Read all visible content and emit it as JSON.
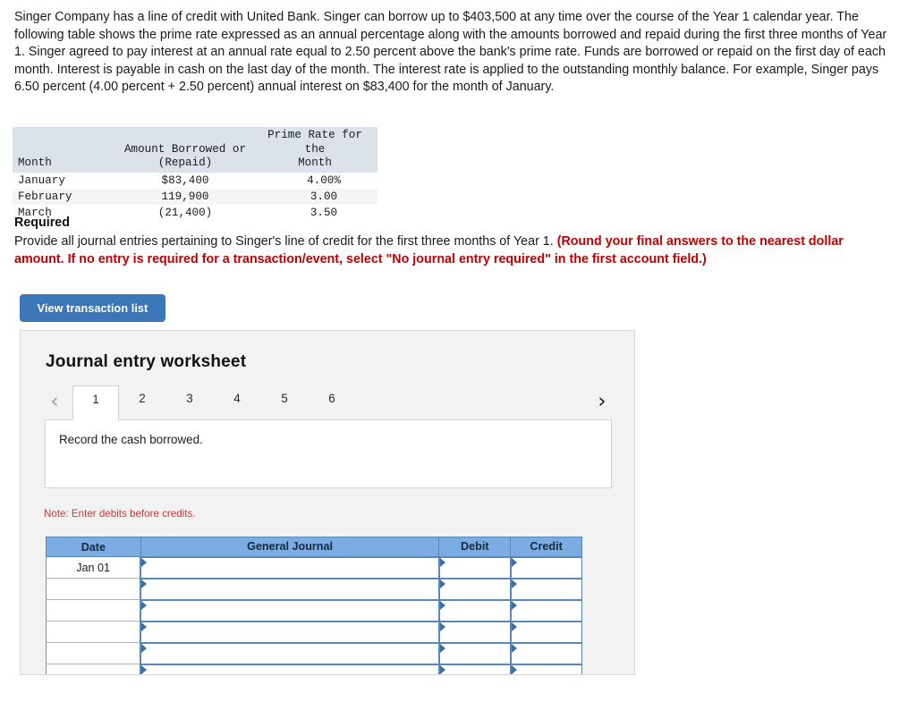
{
  "problem": {
    "text": "Singer Company has a line of credit with United Bank. Singer can borrow up to $403,500 at any time over the course of the Year 1 calendar year. The following table shows the prime rate expressed as an annual percentage along with the amounts borrowed and repaid during the first three months of Year 1. Singer agreed to pay interest at an annual rate equal to 2.50 percent above the bank's prime rate. Funds are borrowed or repaid on the first day of each month. Interest is payable in cash on the last day of the month. The interest rate is applied to the outstanding monthly balance. For example, Singer pays 6.50 percent (4.00 percent + 2.50 percent) annual interest on $83,400 for the month of January."
  },
  "data_table": {
    "headers": {
      "month": "Month",
      "amount_line1": "Amount Borrowed or",
      "amount_line2": "(Repaid)",
      "rate_line1": "Prime Rate for the",
      "rate_line2": "Month"
    },
    "rows": [
      {
        "month": "January",
        "amount": "$83,400",
        "rate": "4.00%"
      },
      {
        "month": "February",
        "amount": "119,900",
        "rate": "3.00"
      },
      {
        "month": "March",
        "amount": "(21,400)",
        "rate": "3.50"
      }
    ]
  },
  "required": {
    "heading": "Required",
    "body": "Provide all journal entries pertaining to Singer's line of credit for the first three months of Year 1. ",
    "hint": "(Round your final answers to the nearest dollar amount. If no entry is required for a transaction/event, select \"No journal entry required\" in the first account field.)"
  },
  "buttons": {
    "view_transaction_list": "View transaction list"
  },
  "worksheet": {
    "title": "Journal entry worksheet",
    "prev_icon": "chevron-left-icon",
    "next_icon": "chevron-right-icon",
    "tabs": [
      {
        "label": "1",
        "active": true
      },
      {
        "label": "2",
        "active": false
      },
      {
        "label": "3",
        "active": false
      },
      {
        "label": "4",
        "active": false
      },
      {
        "label": "5",
        "active": false
      },
      {
        "label": "6",
        "active": false
      }
    ],
    "description": "Record the cash borrowed.",
    "note": "Note: Enter debits before credits.",
    "journal": {
      "headers": [
        "Date",
        "General Journal",
        "Debit",
        "Credit"
      ],
      "rows": [
        {
          "date": "Jan 01",
          "general_journal": "",
          "debit": "",
          "credit": ""
        },
        {
          "date": "",
          "general_journal": "",
          "debit": "",
          "credit": ""
        },
        {
          "date": "",
          "general_journal": "",
          "debit": "",
          "credit": ""
        },
        {
          "date": "",
          "general_journal": "",
          "debit": "",
          "credit": ""
        },
        {
          "date": "",
          "general_journal": "",
          "debit": "",
          "credit": ""
        },
        {
          "date": "",
          "general_journal": "",
          "debit": "",
          "credit": ""
        }
      ]
    }
  },
  "colors": {
    "button_blue": "#3b76b9",
    "journal_header_blue": "#7bace4",
    "data_header_bluegray": "#dce2ea",
    "hint_red": "#c00000",
    "note_red": "#c23b3b",
    "panel_gray": "#f2f2f2"
  }
}
